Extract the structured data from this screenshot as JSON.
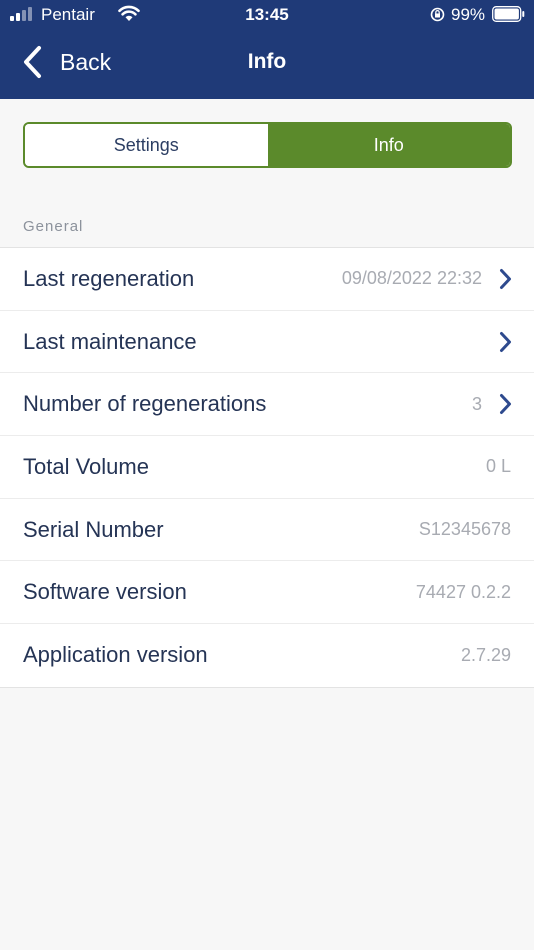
{
  "status_bar": {
    "carrier": "Pentair",
    "time": "13:45",
    "battery": "99%"
  },
  "nav": {
    "back_label": "Back",
    "title": "Info"
  },
  "segment": {
    "settings": "Settings",
    "info": "Info",
    "selected": "Info"
  },
  "section": {
    "title": "General"
  },
  "rows": [
    {
      "label": "Last regeneration",
      "value": "09/08/2022 22:32",
      "chevron": true
    },
    {
      "label": "Last maintenance",
      "value": "",
      "chevron": true
    },
    {
      "label": "Number of regenerations",
      "value": "3",
      "chevron": true
    },
    {
      "label": "Total Volume",
      "value": "0 L",
      "chevron": false
    },
    {
      "label": "Serial Number",
      "value": "S12345678",
      "chevron": false
    },
    {
      "label": "Software version",
      "value": "74427 0.2.2",
      "chevron": false
    },
    {
      "label": "Application version",
      "value": "2.7.29",
      "chevron": false
    }
  ],
  "colors": {
    "header_bg": "#1f3a78",
    "accent_green": "#5b8a2b",
    "chevron_blue": "#2e4a8e"
  },
  "icons": [
    "signal-icon",
    "wifi-icon",
    "rotation-lock-icon",
    "battery-icon",
    "back-chevron-icon",
    "chevron-right-icon"
  ]
}
